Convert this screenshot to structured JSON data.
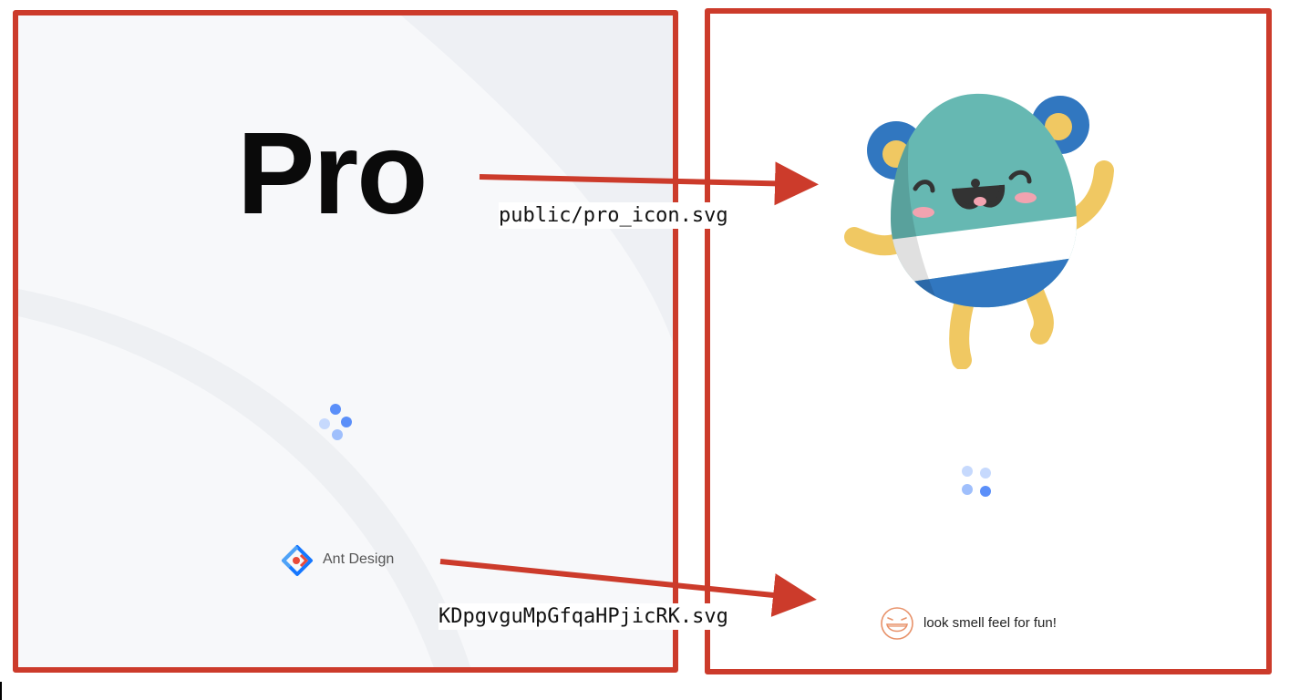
{
  "left_panel": {
    "logo_text": "Pro",
    "footer_brand": "Ant Design",
    "footer_icon": "ant-design-logo-icon",
    "loader_icon": "loading-dots-icon"
  },
  "right_panel": {
    "mascot_icon": "pro-mascot-icon",
    "loader_icon": "loading-dots-icon",
    "footer_icon": "smile-face-icon",
    "footer_text": "look smell feel for fun!"
  },
  "annotations": {
    "pro_icon_path": "public/pro_icon.svg",
    "footer_logo_path": "KDpgvguMpGfqaHPjicRK.svg"
  },
  "colors": {
    "annotation_red": "#cc3b2b",
    "spinner_blue": "#5b8ff9",
    "mascot_teal": "#66b8b2",
    "mascot_blue": "#3177c0",
    "mascot_yellow": "#f0c862",
    "smile_orange": "#e8926a"
  }
}
